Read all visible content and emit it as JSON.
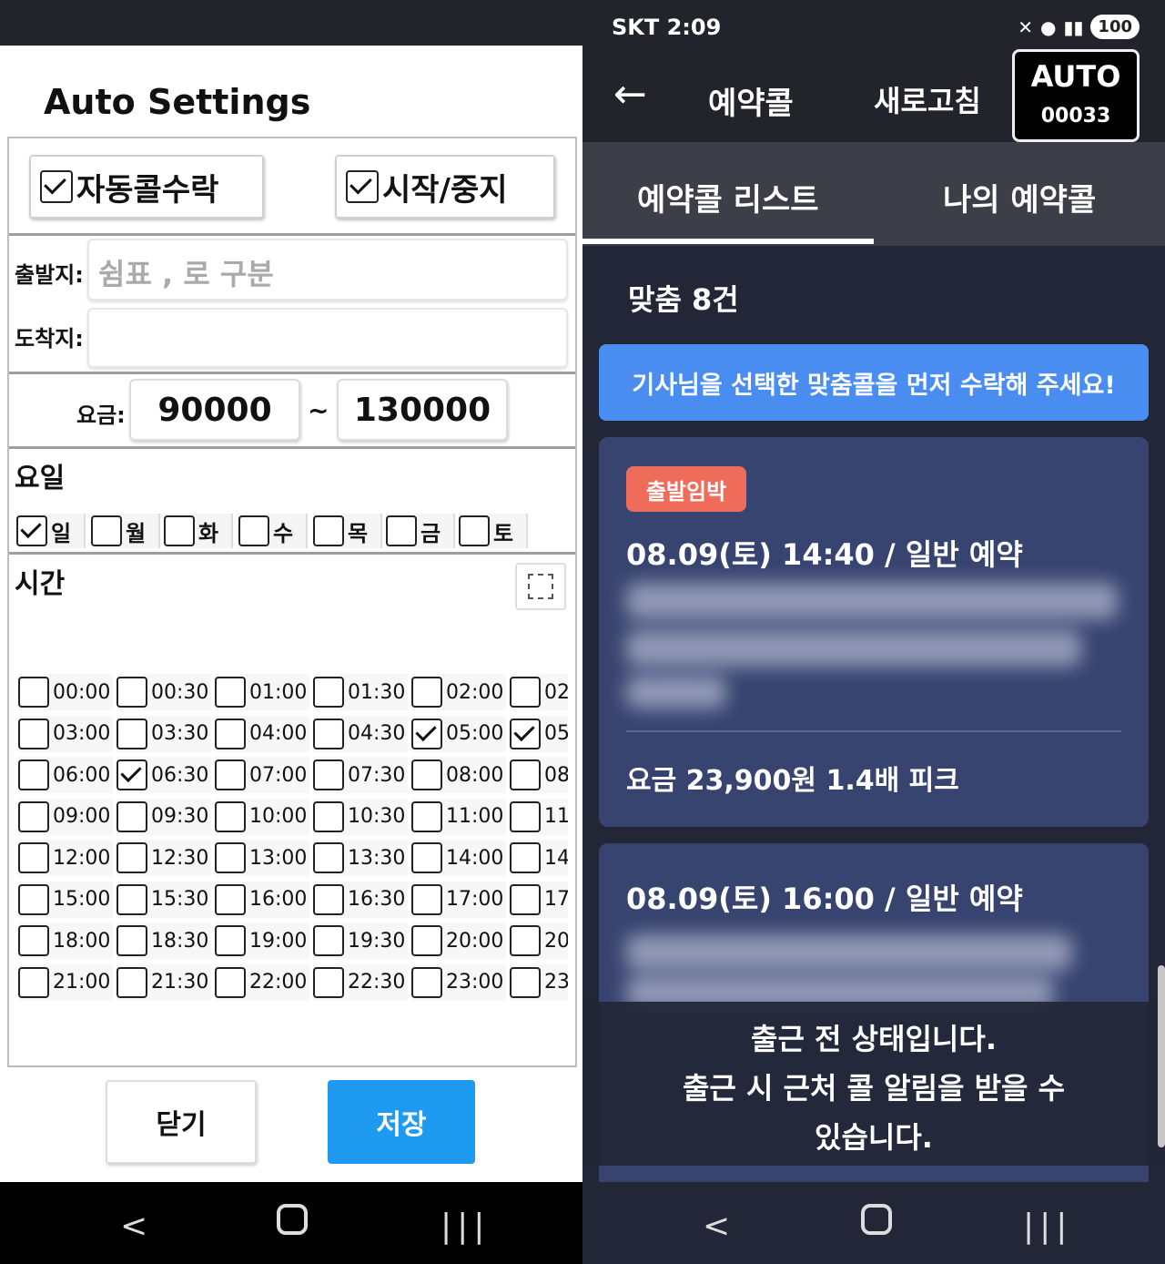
{
  "left": {
    "title": "Auto Settings",
    "auto_accept": {
      "label": "자동콜수락",
      "checked": true
    },
    "start_stop": {
      "label": "시작/중지",
      "checked": true
    },
    "origin": {
      "label": "출발지:",
      "placeholder": "쉼표 , 로 구분"
    },
    "destination": {
      "label": "도착지:"
    },
    "fare": {
      "label": "요금:",
      "min": "90000",
      "tilde": "~",
      "max": "130000"
    },
    "weekday_title": "요일",
    "weekdays": [
      {
        "label": "일",
        "checked": true
      },
      {
        "label": "월",
        "checked": false
      },
      {
        "label": "화",
        "checked": false
      },
      {
        "label": "수",
        "checked": false
      },
      {
        "label": "목",
        "checked": false
      },
      {
        "label": "금",
        "checked": false
      },
      {
        "label": "토",
        "checked": false
      }
    ],
    "time_title": "시간",
    "time_slots": [
      [
        {
          "t": "00:00",
          "c": false
        },
        {
          "t": "00:30",
          "c": false
        },
        {
          "t": "01:00",
          "c": false
        },
        {
          "t": "01:30",
          "c": false
        },
        {
          "t": "02:00",
          "c": false
        },
        {
          "t": "02",
          "c": false
        }
      ],
      [
        {
          "t": "03:00",
          "c": false
        },
        {
          "t": "03:30",
          "c": false
        },
        {
          "t": "04:00",
          "c": false
        },
        {
          "t": "04:30",
          "c": false
        },
        {
          "t": "05:00",
          "c": true
        },
        {
          "t": "05",
          "c": true
        }
      ],
      [
        {
          "t": "06:00",
          "c": false
        },
        {
          "t": "06:30",
          "c": true
        },
        {
          "t": "07:00",
          "c": false
        },
        {
          "t": "07:30",
          "c": false
        },
        {
          "t": "08:00",
          "c": false
        },
        {
          "t": "08",
          "c": false
        }
      ],
      [
        {
          "t": "09:00",
          "c": false
        },
        {
          "t": "09:30",
          "c": false
        },
        {
          "t": "10:00",
          "c": false
        },
        {
          "t": "10:30",
          "c": false
        },
        {
          "t": "11:00",
          "c": false
        },
        {
          "t": "11",
          "c": false
        }
      ],
      [
        {
          "t": "12:00",
          "c": false
        },
        {
          "t": "12:30",
          "c": false
        },
        {
          "t": "13:00",
          "c": false
        },
        {
          "t": "13:30",
          "c": false
        },
        {
          "t": "14:00",
          "c": false
        },
        {
          "t": "14",
          "c": false
        }
      ],
      [
        {
          "t": "15:00",
          "c": false
        },
        {
          "t": "15:30",
          "c": false
        },
        {
          "t": "16:00",
          "c": false
        },
        {
          "t": "16:30",
          "c": false
        },
        {
          "t": "17:00",
          "c": false
        },
        {
          "t": "17",
          "c": false
        }
      ],
      [
        {
          "t": "18:00",
          "c": false
        },
        {
          "t": "18:30",
          "c": false
        },
        {
          "t": "19:00",
          "c": false
        },
        {
          "t": "19:30",
          "c": false
        },
        {
          "t": "20:00",
          "c": false
        },
        {
          "t": "20",
          "c": false
        }
      ],
      [
        {
          "t": "21:00",
          "c": false
        },
        {
          "t": "21:30",
          "c": false
        },
        {
          "t": "22:00",
          "c": false
        },
        {
          "t": "22:30",
          "c": false
        },
        {
          "t": "23:00",
          "c": false
        },
        {
          "t": "23",
          "c": false
        }
      ]
    ],
    "close_label": "닫기",
    "save_label": "저장",
    "colors": {
      "save_bg": "#1e9bf0",
      "panel_border": "#bdbdbd"
    }
  },
  "right": {
    "status": {
      "carrier_time": "SKT 2:09",
      "battery": "100"
    },
    "appbar": {
      "title": "예약콜",
      "refresh": "새로고침",
      "auto_label": "AUTO",
      "auto_count": "00033"
    },
    "tabs": [
      "예약콜 리스트",
      "나의 예약콜"
    ],
    "match_count": "맞춤 8건",
    "banner": "기사님을 선택한 맞춤콜을 먼저 수락해 주세요!",
    "cards": [
      {
        "badge": "출발임박",
        "datetime": "08.09(토) 14:40 / 일반 예약",
        "fare": "요금 23,900원 1.4배 피크"
      },
      {
        "datetime": "08.09(토) 16:00 / 일반 예약"
      }
    ],
    "toast": [
      "출근 전 상태입니다.",
      "출근 시 근처 콜 알림을 받을 수",
      "있습니다."
    ],
    "colors": {
      "banner": "#4a8df0",
      "card": "#384470",
      "badge": "#ef6c5a",
      "bg": "#222636"
    }
  }
}
